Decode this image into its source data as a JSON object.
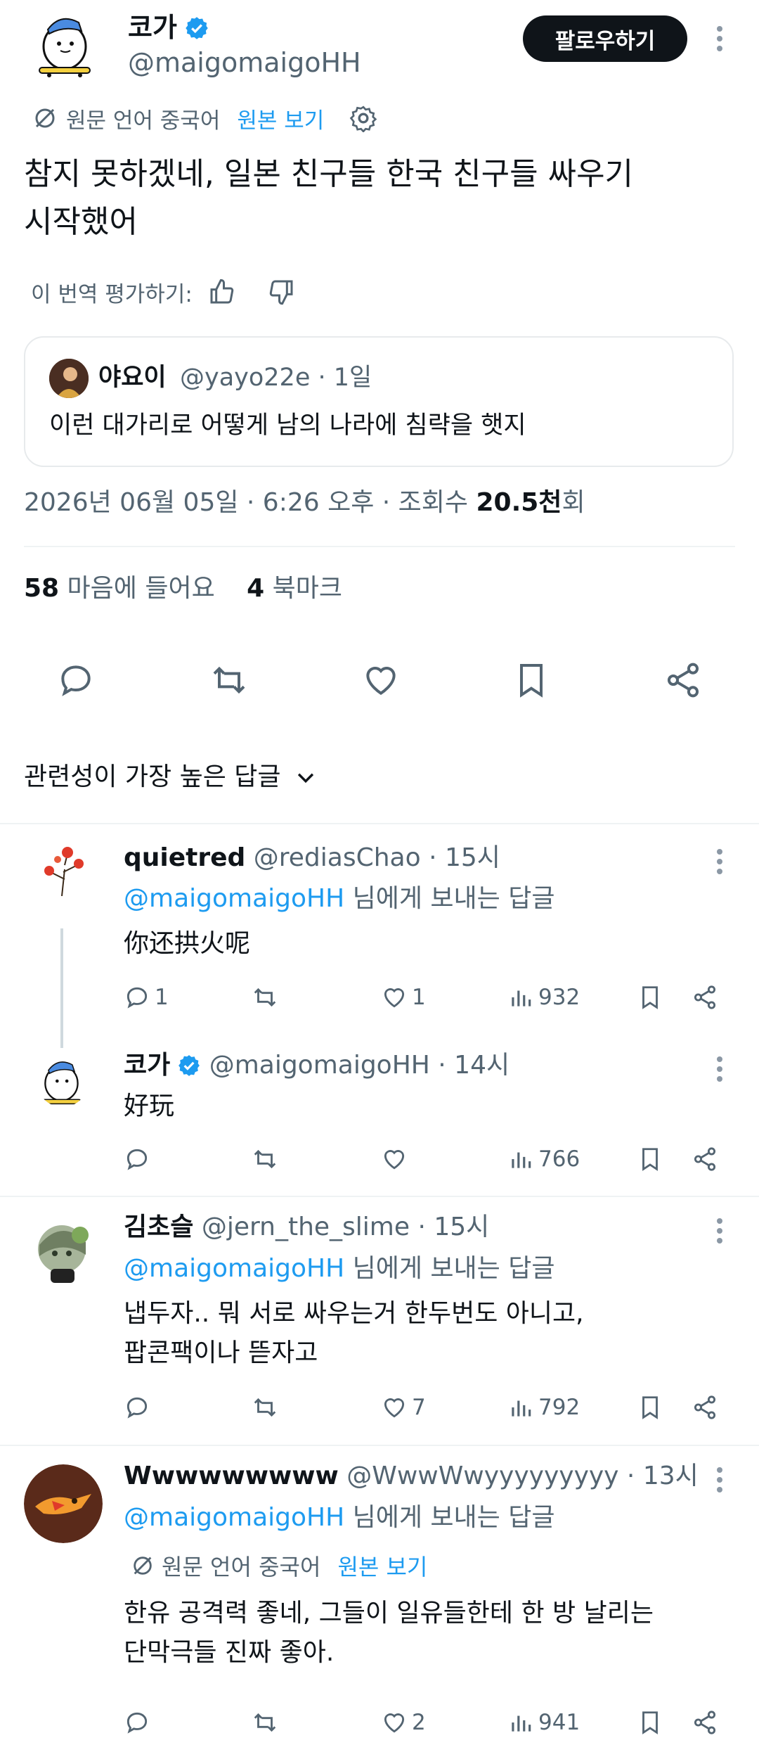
{
  "tweet": {
    "author_name": "코가",
    "author_handle": "@maigomaigoHH",
    "follow_label": "팔로우하기",
    "translated_from": "원문 언어 중국어",
    "show_original": "원본 보기",
    "text_line1": "참지 못하겠네, 일본 친구들 한국 친구들 싸우기",
    "text_line2": "시작했어",
    "rate_label": "이 번역 평가하기:",
    "quote": {
      "name": "야요이",
      "meta": "@yayo22e · 1일",
      "text": "이런 대가리로 어떻게 남의 나라에 침략을 햇지"
    },
    "date_time": "2026년 06월 05일 · 6:26 오후 · 조회수 ",
    "views": "20.5천",
    "views_suffix": "회",
    "likes_count": "58",
    "likes_label": " 마음에 들어요",
    "bookmarks_count": "4",
    "bookmarks_label": " 북마크"
  },
  "sort_label": "관련성이 가장 높은 답글",
  "replies": [
    {
      "name": "quietred",
      "meta": " @rediasChao · 15시",
      "mention": "@maigomaigoHH",
      "reply_to": " 님에게 보내는 답글",
      "text": "你还拱火呢",
      "replies": "1",
      "retweets": "",
      "likes": "1",
      "views": "932"
    },
    {
      "name": "코가",
      "meta": " @maigomaigoHH · 14시",
      "text": "好玩",
      "replies": "",
      "retweets": "",
      "likes": "",
      "views": "766"
    },
    {
      "name": "김초슬",
      "meta": " @jern_the_slime · 15시",
      "mention": "@maigomaigoHH",
      "reply_to": " 님에게 보내는 답글",
      "text_line1": "냅두자.. 뭐 서로 싸우는거 한두번도 아니고,",
      "text_line2": "팝콘팩이나 뜯자고",
      "replies": "",
      "retweets": "",
      "likes": "7",
      "views": "792"
    },
    {
      "name": "Wwwwwwwww",
      "meta": " @WwwWwyyyyyyyyy · 13시",
      "mention": "@maigomaigoHH",
      "reply_to": " 님에게 보내는 답글",
      "translated_from": "원문 언어 중국어",
      "show_original": "원본 보기",
      "text_line1": "한유 공격력 좋네, 그들이 일유들한테 한 방 날리는",
      "text_line2": "단막극들 진짜 좋아.",
      "replies": "",
      "retweets": "",
      "likes": "2",
      "views": "941"
    }
  ],
  "colors": {
    "link": "#1d9bf0",
    "secondary_text": "#536471",
    "primary_text": "#0f1419",
    "verified": "#1d9bf0"
  }
}
